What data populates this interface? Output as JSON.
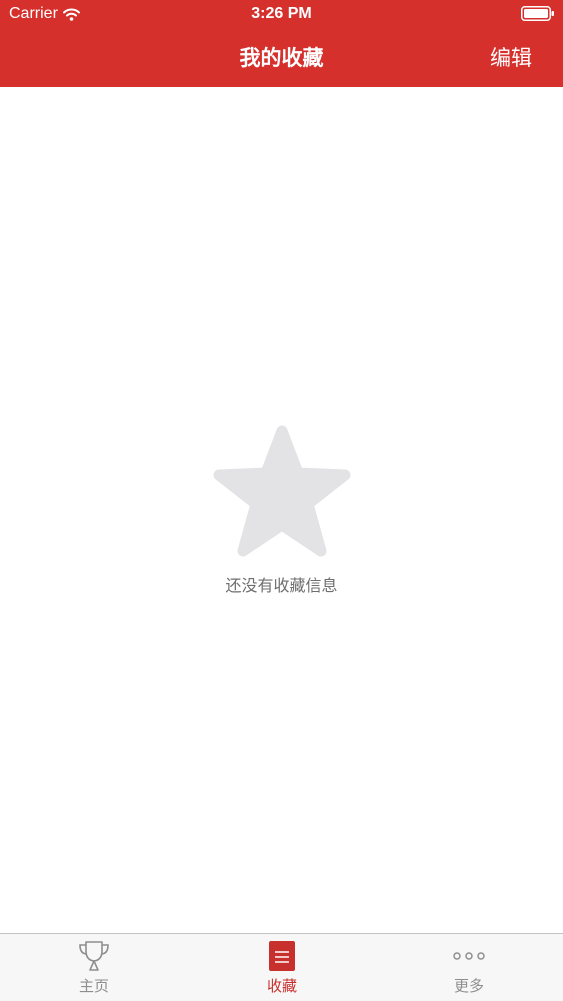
{
  "status_bar": {
    "carrier": "Carrier",
    "time": "3:26 PM"
  },
  "nav": {
    "title": "我的收藏",
    "edit_label": "编辑"
  },
  "empty_state": {
    "message": "还没有收藏信息",
    "icon": "star-icon"
  },
  "tabs": [
    {
      "label": "主页",
      "icon": "trophy-icon",
      "active": false
    },
    {
      "label": "收藏",
      "icon": "bookmark-list-icon",
      "active": true
    },
    {
      "label": "更多",
      "icon": "more-dots-icon",
      "active": false
    }
  ],
  "colors": {
    "brand": "#d6302d",
    "tab_active": "#c8302d",
    "tab_inactive": "#8e8e8e",
    "empty_star": "#e3e3e6"
  }
}
